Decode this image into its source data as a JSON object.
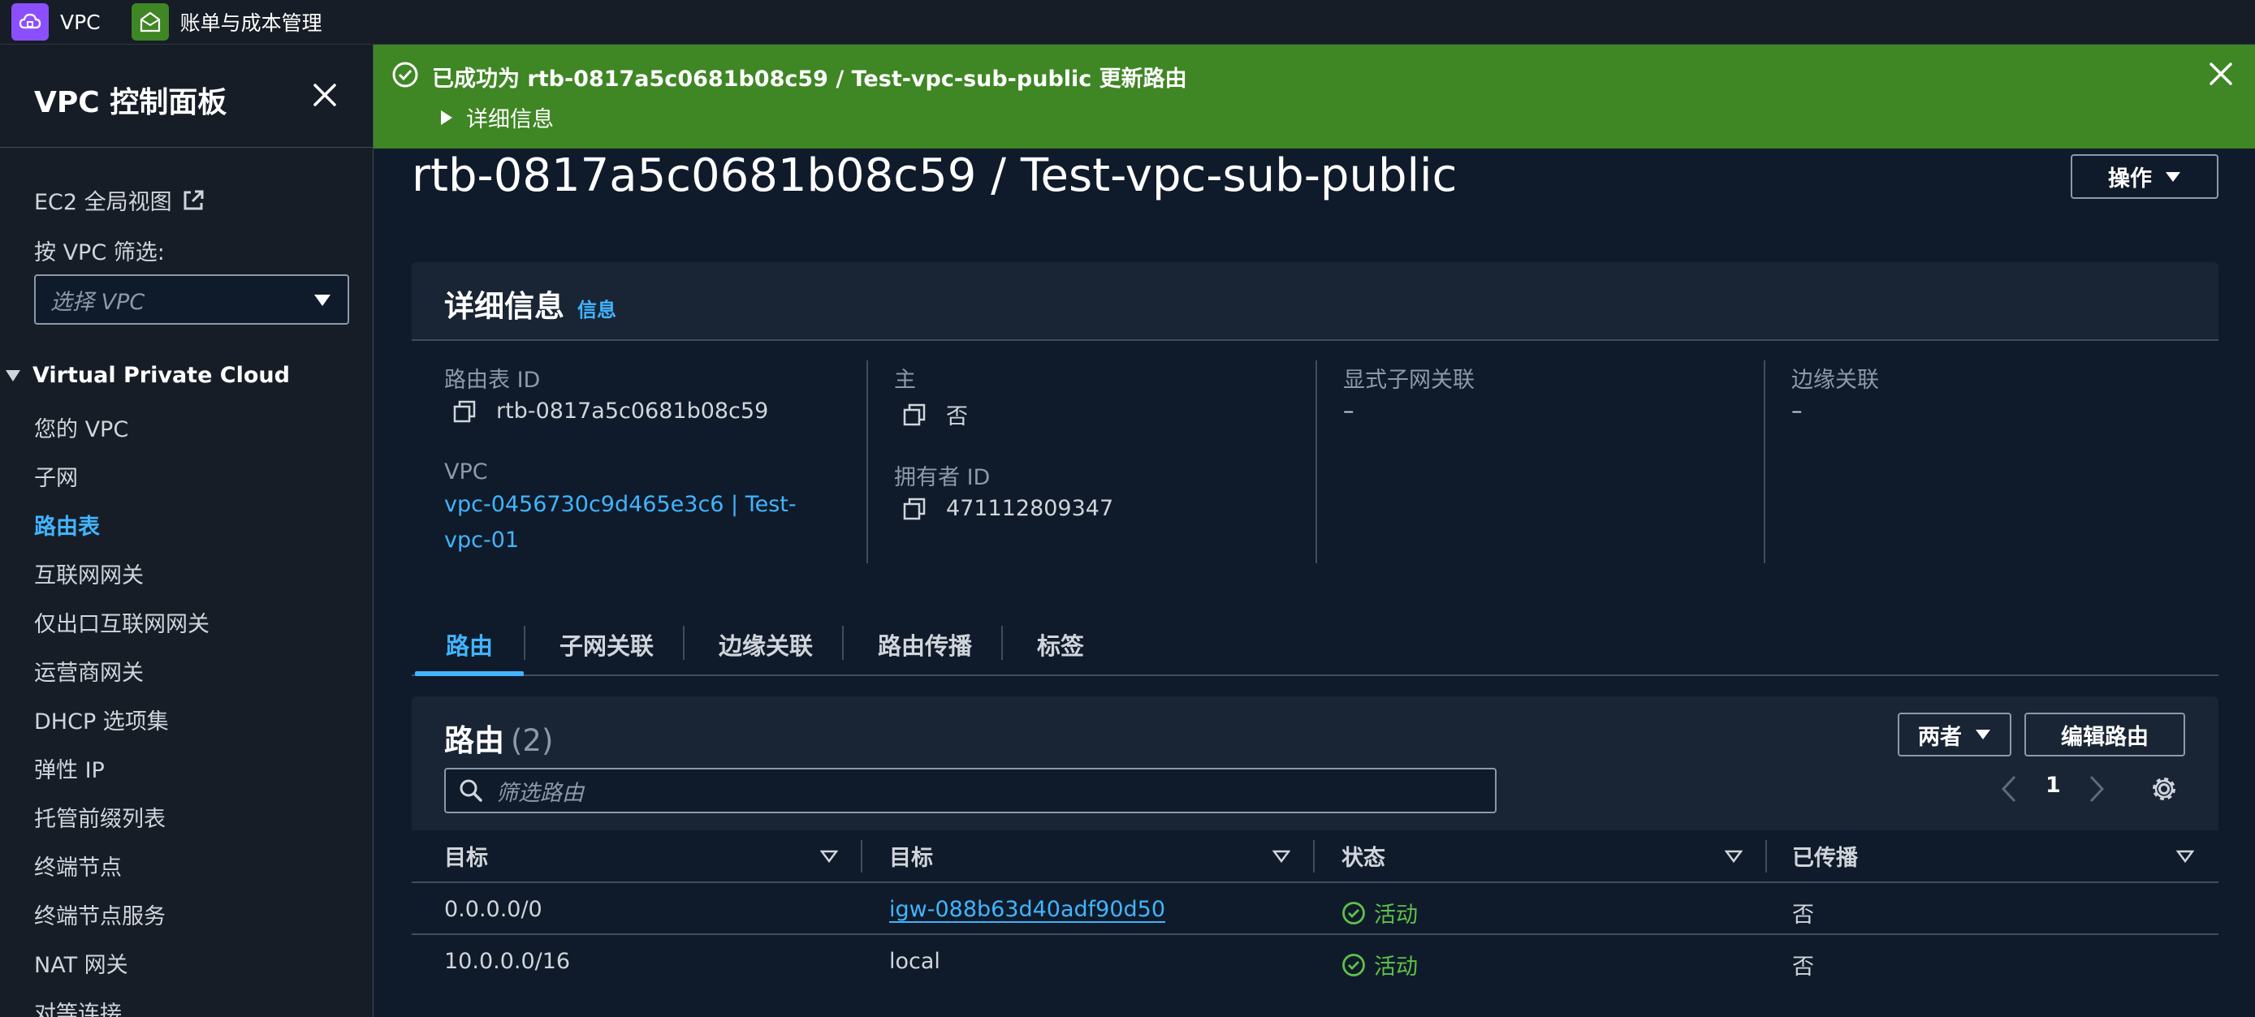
{
  "topbar": {
    "services": [
      {
        "label": "VPC",
        "icon": "vpc-cloud-icon"
      },
      {
        "label": "账单与成本管理",
        "icon": "billing-icon"
      }
    ]
  },
  "sidebar": {
    "title": "VPC 控制面板",
    "ec2_link": "EC2 全局视图",
    "filter_label": "按 VPC 筛选:",
    "filter_placeholder": "选择 VPC",
    "section": "Virtual Private Cloud",
    "items": [
      {
        "label": "您的 VPC"
      },
      {
        "label": "子网"
      },
      {
        "label": "路由表",
        "active": true
      },
      {
        "label": "互联网网关"
      },
      {
        "label": "仅出口互联网网关"
      },
      {
        "label": "运营商网关"
      },
      {
        "label": "DHCP 选项集"
      },
      {
        "label": "弹性 IP"
      },
      {
        "label": "托管前缀列表"
      },
      {
        "label": "终端节点"
      },
      {
        "label": "终端节点服务"
      },
      {
        "label": "NAT 网关"
      },
      {
        "label": "对等连接"
      }
    ]
  },
  "flash": {
    "message": "已成功为 rtb-0817a5c0681b08c59 / Test-vpc-sub-public 更新路由",
    "detail": "详细信息",
    "color": "#3f8624"
  },
  "page": {
    "title": "rtb-0817a5c0681b08c59 / Test-vpc-sub-public",
    "actions_label": "操作"
  },
  "details": {
    "heading": "详细信息",
    "info_link": "信息",
    "route_table_id_label": "路由表 ID",
    "route_table_id": "rtb-0817a5c0681b08c59",
    "vpc_label": "VPC",
    "vpc_value": "vpc-0456730c9d465e3c6 | Test-vpc-01",
    "main_label": "主",
    "main_value": "否",
    "owner_label": "拥有者 ID",
    "owner_value": "471112809347",
    "explicit_subnet_label": "显式子网关联",
    "explicit_subnet_value": "–",
    "edge_label": "边缘关联",
    "edge_value": "–"
  },
  "tabs": [
    {
      "label": "路由",
      "active": true
    },
    {
      "label": "子网关联"
    },
    {
      "label": "边缘关联"
    },
    {
      "label": "路由传播"
    },
    {
      "label": "标签"
    }
  ],
  "routes": {
    "title": "路由",
    "count": "(2)",
    "filter_dropdown": "两者",
    "edit_button": "编辑路由",
    "search_placeholder": "筛选路由",
    "page": "1",
    "columns": [
      "目标",
      "目标",
      "状态",
      "已传播"
    ],
    "rows": [
      {
        "destination": "0.0.0.0/0",
        "target": "igw-088b63d40adf90d50",
        "status": "活动",
        "propagated": "否"
      },
      {
        "destination": "10.0.0.0/16",
        "target": "local",
        "status": "活动",
        "propagated": "否"
      }
    ]
  }
}
